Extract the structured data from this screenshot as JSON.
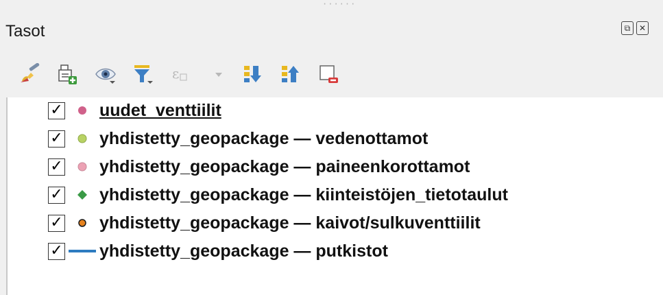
{
  "panel": {
    "title": "Tasot",
    "controls": [
      {
        "icon": "float-icon",
        "glyph": "⧉"
      },
      {
        "icon": "close-icon",
        "glyph": "✕"
      }
    ]
  },
  "toolbar": [
    {
      "icon": "style-brush-icon"
    },
    {
      "icon": "add-group-icon"
    },
    {
      "icon": "visibility-eye-icon"
    },
    {
      "icon": "filter-legend-icon"
    },
    {
      "icon": "filter-expression-icon",
      "disabled": true
    },
    {
      "icon": "expand-all-icon"
    },
    {
      "icon": "collapse-all-icon"
    },
    {
      "icon": "remove-layer-icon"
    }
  ],
  "layers": [
    {
      "checked": true,
      "check_glyph": "✓",
      "symbol": "circle",
      "color": "#d0618a",
      "name": "uudet_venttiilit",
      "underlined": true
    },
    {
      "checked": true,
      "check_glyph": "✓",
      "symbol": "circle",
      "color": "#b8d264",
      "name": "yhdistetty_geopackage — vedenottamot"
    },
    {
      "checked": true,
      "check_glyph": "✓",
      "symbol": "circle",
      "color": "#eca2b4",
      "name": "yhdistetty_geopackage — paineenkorottamot"
    },
    {
      "checked": true,
      "check_glyph": "✓",
      "symbol": "diamond",
      "color": "#3a9a46",
      "name": "yhdistetty_geopackage — kiinteistöjen_tietotaulut"
    },
    {
      "checked": true,
      "check_glyph": "✓",
      "symbol": "circle",
      "color": "#e6821e",
      "name": "yhdistetty_geopackage — kaivot/sulkuventtiilit"
    },
    {
      "checked": true,
      "check_glyph": "✓",
      "symbol": "line",
      "color": "#2e7cc0",
      "name": "yhdistetty_geopackage — putkistot"
    }
  ]
}
